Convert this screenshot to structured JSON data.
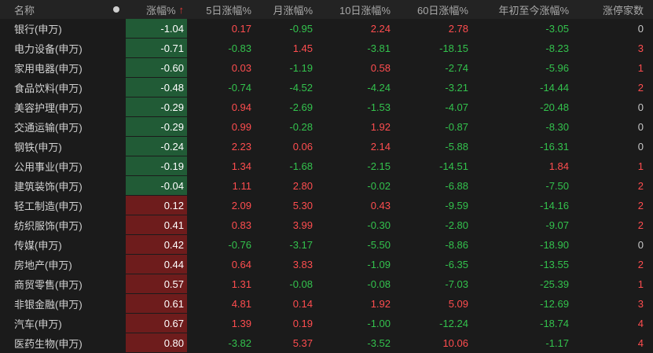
{
  "header": {
    "name": "名称",
    "change": "涨幅%",
    "sort_arrow": "↑",
    "d5": "5日涨幅%",
    "month": "月涨幅%",
    "d10": "10日涨幅%",
    "d60": "60日涨幅%",
    "ytd": "年初至今涨幅%",
    "limit_up": "涨停家数"
  },
  "colors": {
    "up": "#ff4d4f",
    "down": "#33c24d",
    "neg_bg": "#215b36",
    "pos_bg": "#6e1c1c"
  },
  "rows": [
    {
      "name": "银行(申万)",
      "chg": "-1.04",
      "d5": "0.17",
      "m": "-0.95",
      "d10": "2.24",
      "d60": "2.78",
      "ytd": "-3.05",
      "lim": "0"
    },
    {
      "name": "电力设备(申万)",
      "chg": "-0.71",
      "d5": "-0.83",
      "m": "1.45",
      "d10": "-3.81",
      "d60": "-18.15",
      "ytd": "-8.23",
      "lim": "3"
    },
    {
      "name": "家用电器(申万)",
      "chg": "-0.60",
      "d5": "0.03",
      "m": "-1.19",
      "d10": "0.58",
      "d60": "-2.74",
      "ytd": "-5.96",
      "lim": "1"
    },
    {
      "name": "食品饮料(申万)",
      "chg": "-0.48",
      "d5": "-0.74",
      "m": "-4.52",
      "d10": "-4.24",
      "d60": "-3.21",
      "ytd": "-14.44",
      "lim": "2"
    },
    {
      "name": "美容护理(申万)",
      "chg": "-0.29",
      "d5": "0.94",
      "m": "-2.69",
      "d10": "-1.53",
      "d60": "-4.07",
      "ytd": "-20.48",
      "lim": "0"
    },
    {
      "name": "交通运输(申万)",
      "chg": "-0.29",
      "d5": "0.99",
      "m": "-0.28",
      "d10": "1.92",
      "d60": "-0.87",
      "ytd": "-8.30",
      "lim": "0"
    },
    {
      "name": "钢铁(申万)",
      "chg": "-0.24",
      "d5": "2.23",
      "m": "0.06",
      "d10": "2.14",
      "d60": "-5.88",
      "ytd": "-16.31",
      "lim": "0"
    },
    {
      "name": "公用事业(申万)",
      "chg": "-0.19",
      "d5": "1.34",
      "m": "-1.68",
      "d10": "-2.15",
      "d60": "-14.51",
      "ytd": "1.84",
      "lim": "1"
    },
    {
      "name": "建筑装饰(申万)",
      "chg": "-0.04",
      "d5": "1.11",
      "m": "2.80",
      "d10": "-0.02",
      "d60": "-6.88",
      "ytd": "-7.50",
      "lim": "2"
    },
    {
      "name": "轻工制造(申万)",
      "chg": "0.12",
      "d5": "2.09",
      "m": "5.30",
      "d10": "0.43",
      "d60": "-9.59",
      "ytd": "-14.16",
      "lim": "2"
    },
    {
      "name": "纺织服饰(申万)",
      "chg": "0.41",
      "d5": "0.83",
      "m": "3.99",
      "d10": "-0.30",
      "d60": "-2.80",
      "ytd": "-9.07",
      "lim": "2"
    },
    {
      "name": "传媒(申万)",
      "chg": "0.42",
      "d5": "-0.76",
      "m": "-3.17",
      "d10": "-5.50",
      "d60": "-8.86",
      "ytd": "-18.90",
      "lim": "0"
    },
    {
      "name": "房地产(申万)",
      "chg": "0.44",
      "d5": "0.64",
      "m": "3.83",
      "d10": "-1.09",
      "d60": "-6.35",
      "ytd": "-13.55",
      "lim": "2"
    },
    {
      "name": "商贸零售(申万)",
      "chg": "0.57",
      "d5": "1.31",
      "m": "-0.08",
      "d10": "-0.08",
      "d60": "-7.03",
      "ytd": "-25.39",
      "lim": "1"
    },
    {
      "name": "非银金融(申万)",
      "chg": "0.61",
      "d5": "4.81",
      "m": "0.14",
      "d10": "1.92",
      "d60": "5.09",
      "ytd": "-12.69",
      "lim": "3"
    },
    {
      "name": "汽车(申万)",
      "chg": "0.67",
      "d5": "1.39",
      "m": "0.19",
      "d10": "-1.00",
      "d60": "-12.24",
      "ytd": "-18.74",
      "lim": "4"
    },
    {
      "name": "医药生物(申万)",
      "chg": "0.80",
      "d5": "-3.82",
      "m": "5.37",
      "d10": "-3.52",
      "d60": "10.06",
      "ytd": "-1.17",
      "lim": "4"
    }
  ]
}
